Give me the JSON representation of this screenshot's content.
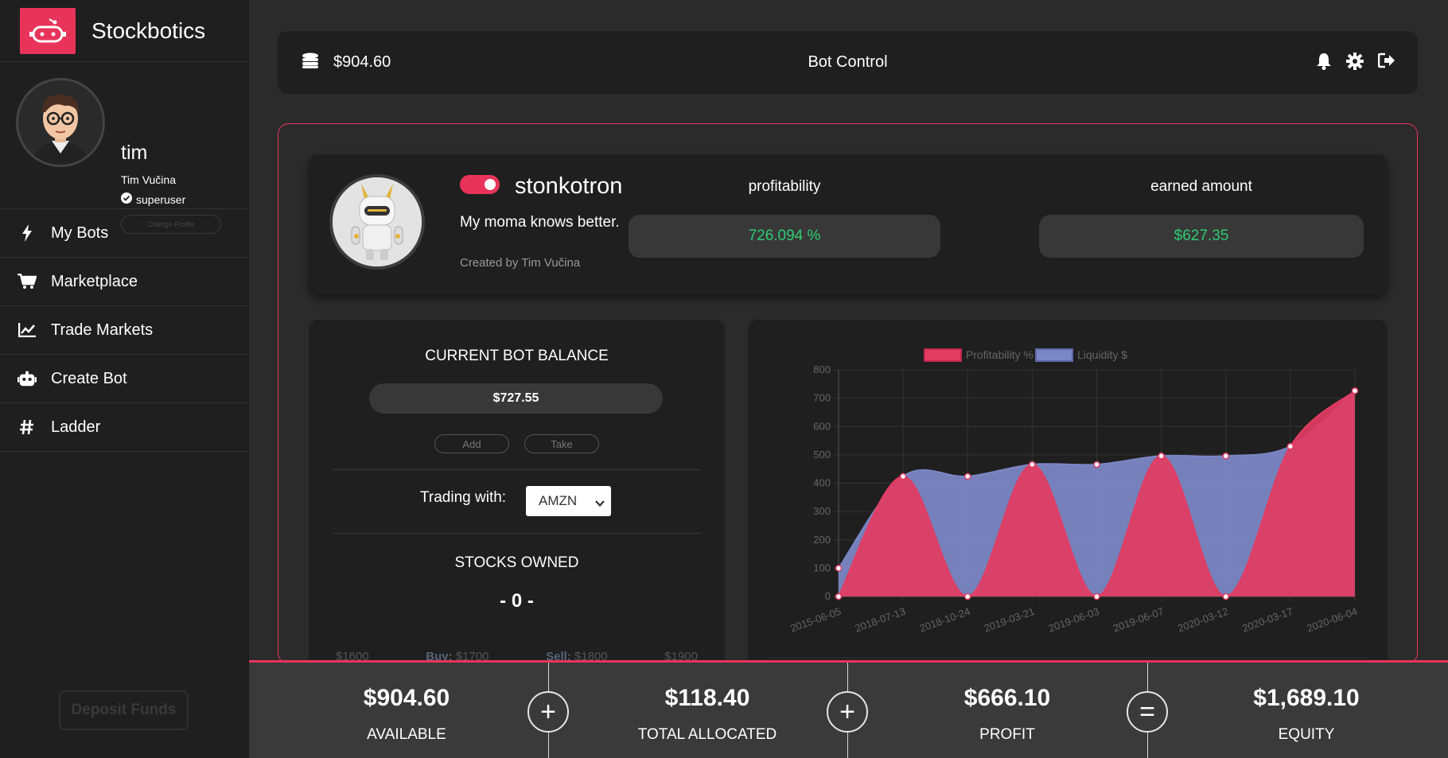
{
  "app": {
    "name": "Stockbotics"
  },
  "user": {
    "username": "tim",
    "full_name": "Tim Vučina",
    "role": "superuser",
    "change_profile_label": "Change Profile"
  },
  "nav": [
    {
      "label": "My Bots",
      "icon": "bolt-icon"
    },
    {
      "label": "Marketplace",
      "icon": "cart-icon"
    },
    {
      "label": "Trade Markets",
      "icon": "chart-line-icon"
    },
    {
      "label": "Create Bot",
      "icon": "robot-icon"
    },
    {
      "label": "Ladder",
      "icon": "hashtag-icon"
    }
  ],
  "deposit_label": "Deposit Funds",
  "topbar": {
    "balance": "$904.60",
    "title": "Bot Control"
  },
  "bot": {
    "name": "stonkotron",
    "enabled": true,
    "description": "My moma knows better.",
    "created_by": "Created by Tim Vučina",
    "profitability_label": "profitability",
    "profitability_value": "726.094 %",
    "earned_label": "earned amount",
    "earned_value": "$627.35"
  },
  "balance_card": {
    "title": "CURRENT BOT BALANCE",
    "amount": "$727.55",
    "add_label": "Add",
    "take_label": "Take",
    "trading_label": "Trading with:",
    "trading_symbol": "AMZN",
    "stocks_title": "STOCKS OWNED",
    "stocks_value": "- 0 -",
    "prices": {
      "p1": "$1600",
      "buy_label": "Buy:",
      "buy": "$1700",
      "sell_label": "Sell:",
      "sell": "$1800",
      "p4": "$1900"
    }
  },
  "chart_data": {
    "type": "area",
    "x": [
      "2015-06-05",
      "2018-07-13",
      "2018-10-24",
      "2019-03-21",
      "2019-06-03",
      "2019-06-07",
      "2020-03-12",
      "2020-03-17",
      "2020-06-04"
    ],
    "series": [
      {
        "name": "Profitability %",
        "color": "#e23c62",
        "values": [
          0,
          424,
          0,
          466,
          0,
          496,
          0,
          530,
          726
        ]
      },
      {
        "name": "Liquidity $",
        "color": "#7b86c4",
        "values": [
          100,
          424,
          424,
          466,
          466,
          496,
          496,
          530,
          726
        ]
      }
    ],
    "ylim": [
      0,
      800
    ],
    "yticks": [
      0,
      100,
      200,
      300,
      400,
      500,
      600,
      700,
      800
    ],
    "legend": "top",
    "grid": true
  },
  "totals": {
    "available": "$904.60",
    "available_label": "AVAILABLE",
    "allocated": "$118.40",
    "allocated_label": "TOTAL ALLOCATED",
    "profit": "$666.10",
    "profit_label": "PROFIT",
    "equity": "$1,689.10",
    "equity_label": "EQUITY",
    "op1": "+",
    "op2": "+",
    "op3": "="
  }
}
